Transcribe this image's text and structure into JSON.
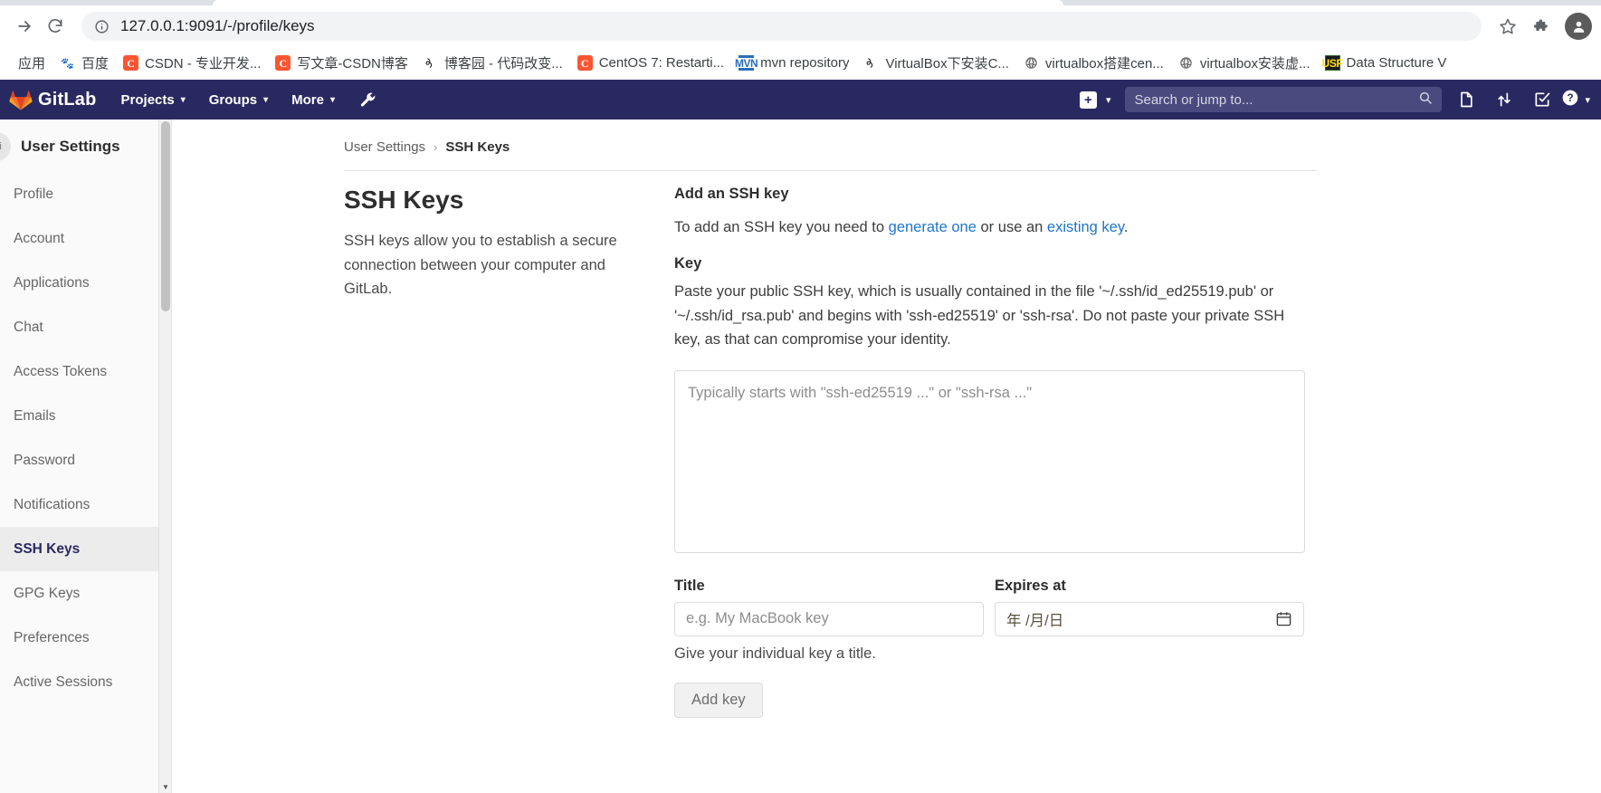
{
  "browser": {
    "url": "127.0.0.1:9091/-/profile/keys",
    "forward_icon": "forward-arrow-icon",
    "reload_icon": "reload-icon",
    "info_icon": "site-info-icon",
    "star_icon": "bookmark-star-icon",
    "extensions_icon": "extensions-puzzle-icon",
    "profile_icon": "profile-avatar-icon",
    "bookmarks": [
      {
        "label": "应用",
        "icon": "apps-icon"
      },
      {
        "label": "百度",
        "icon": "baidu-icon"
      },
      {
        "label": "CSDN - 专业开发...",
        "icon": "csdn-icon"
      },
      {
        "label": "写文章-CSDN博客",
        "icon": "csdn-icon"
      },
      {
        "label": "博客园 - 代码改变...",
        "icon": "cnblogs-icon"
      },
      {
        "label": "CentOS 7: Restarti...",
        "icon": "csdn-icon"
      },
      {
        "label": "mvn repository",
        "icon": "mvn-icon"
      },
      {
        "label": "VirtualBox下安装C...",
        "icon": "cnblogs-icon"
      },
      {
        "label": "virtualbox搭建cen...",
        "icon": "globe-icon"
      },
      {
        "label": "virtualbox安装虚...",
        "icon": "globe-icon"
      },
      {
        "label": "Data Structure V",
        "icon": "usf-icon"
      }
    ]
  },
  "gitlab_nav": {
    "brand": "GitLab",
    "logo_icon": "gitlab-tanuki-icon",
    "items": [
      {
        "label": "Projects",
        "caret": "▾"
      },
      {
        "label": "Groups",
        "caret": "▾"
      },
      {
        "label": "More",
        "caret": "▾"
      }
    ],
    "wrench_icon": "wrench-admin-icon",
    "plus_icon": "plus-new-icon",
    "plus_caret": "▾",
    "search_placeholder": "Search or jump to...",
    "search_icon": "search-magnifier-icon",
    "icons": [
      {
        "name": "issues-icon",
        "glyph": "issues"
      },
      {
        "name": "merge-requests-icon",
        "glyph": "merge"
      },
      {
        "name": "todos-icon",
        "glyph": "todo"
      }
    ],
    "help_icon": "help-question-icon",
    "help_caret": "▾"
  },
  "sidebar": {
    "title": "User Settings",
    "avatar_text": "mi",
    "scroll_up_glyph": "▲",
    "scroll_down_glyph": "▼",
    "items": [
      {
        "label": "Profile",
        "icon": "profile-icon",
        "active": false
      },
      {
        "label": "Account",
        "icon": "account-icon",
        "active": false
      },
      {
        "label": "Applications",
        "icon": "applications-icon",
        "active": false
      },
      {
        "label": "Chat",
        "icon": "chat-icon",
        "active": false
      },
      {
        "label": "Access Tokens",
        "icon": "token-icon",
        "active": false
      },
      {
        "label": "Emails",
        "icon": "email-icon",
        "active": false
      },
      {
        "label": "Password",
        "icon": "password-icon",
        "active": false
      },
      {
        "label": "Notifications",
        "icon": "notifications-icon",
        "active": false
      },
      {
        "label": "SSH Keys",
        "icon": "ssh-key-icon",
        "active": true
      },
      {
        "label": "GPG Keys",
        "icon": "gpg-key-icon",
        "active": false
      },
      {
        "label": "Preferences",
        "icon": "preferences-icon",
        "active": false
      },
      {
        "label": "Active Sessions",
        "icon": "sessions-icon",
        "active": false
      }
    ]
  },
  "breadcrumb": {
    "parent": "User Settings",
    "separator": "›",
    "current": "SSH Keys"
  },
  "main": {
    "heading": "SSH Keys",
    "intro": "SSH keys allow you to establish a secure connection between your computer and GitLab.",
    "form": {
      "section_title": "Add an SSH key",
      "desc_prefix": "To add an SSH key you need to ",
      "desc_link1": "generate one",
      "desc_middle": " or use an ",
      "desc_link2": "existing key",
      "desc_suffix": ".",
      "key_label": "Key",
      "key_help": "Paste your public SSH key, which is usually contained in the file '~/.ssh/id_ed25519.pub' or '~/.ssh/id_rsa.pub' and begins with 'ssh-ed25519' or 'ssh-rsa'. Do not paste your private SSH key, as that can compromise your identity.",
      "key_placeholder": "Typically starts with \"ssh-ed25519 ...\" or \"ssh-rsa ...\"",
      "key_value": "",
      "title_label": "Title",
      "title_placeholder": "e.g. My MacBook key",
      "title_value": "",
      "title_hint": "Give your individual key a title.",
      "expires_label": "Expires at",
      "expires_placeholder": "年 /月/日",
      "calendar_icon": "calendar-icon",
      "submit_label": "Add key"
    }
  },
  "colors": {
    "gitlab_navy": "#292961",
    "link_blue": "#1f75cb",
    "sidebar_bg": "#fafafa",
    "active_bg": "#ececec"
  }
}
